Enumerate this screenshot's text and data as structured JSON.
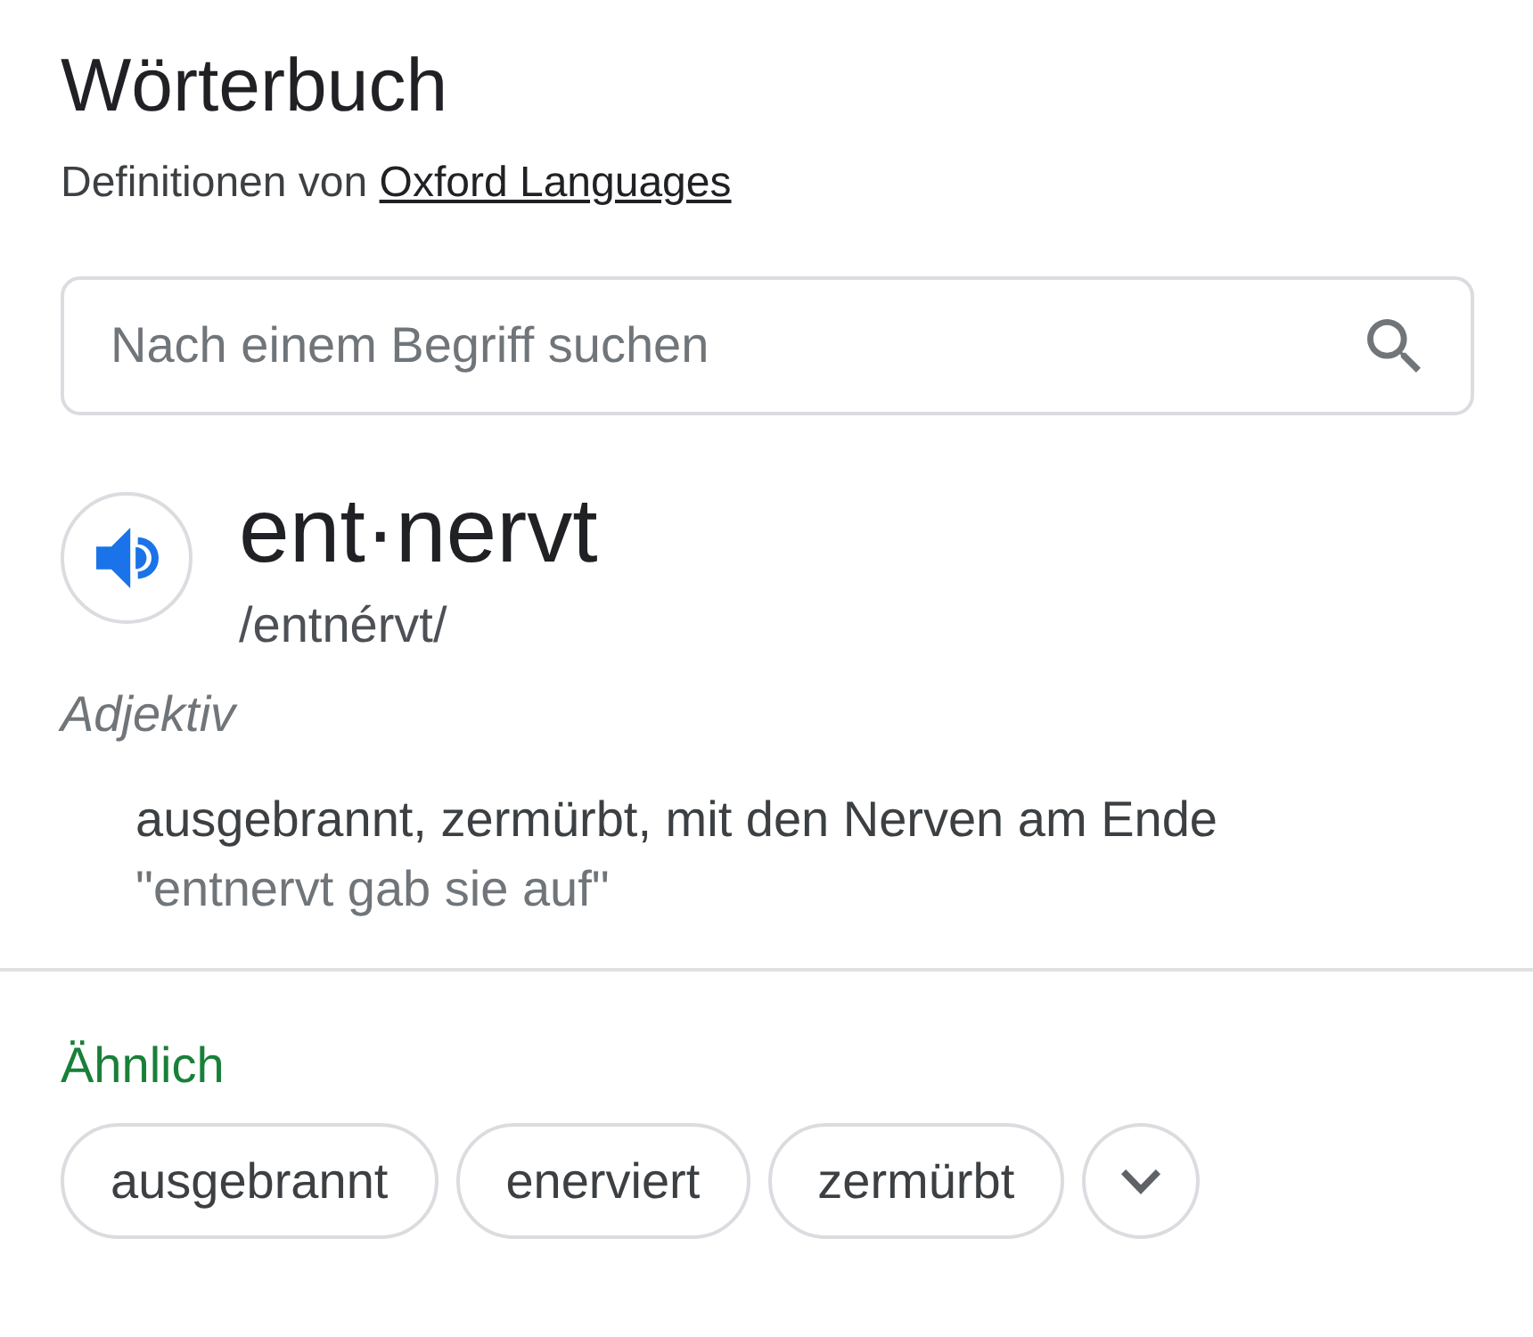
{
  "header": {
    "title": "Wörterbuch",
    "source_prefix": "Definitionen von",
    "source_link": "Oxford Languages"
  },
  "search": {
    "placeholder": "Nach einem Begriff suchen"
  },
  "entry": {
    "headword": "ent·nervt",
    "pronunciation": "/entnérvt/",
    "part_of_speech": "Adjektiv",
    "definitions": [
      {
        "text": "ausgebrannt, zermürbt, mit den Nerven am Ende",
        "example": "\"entnervt gab sie auf\""
      }
    ]
  },
  "similar": {
    "label": "Ähnlich",
    "chips": [
      "ausgebrannt",
      "enerviert",
      "zermürbt"
    ]
  }
}
